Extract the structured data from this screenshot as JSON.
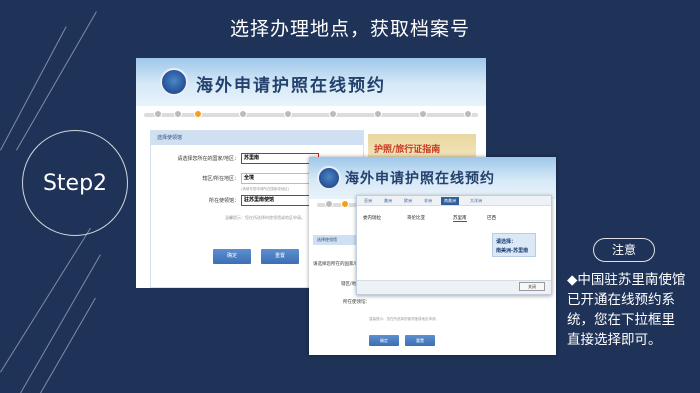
{
  "slide": {
    "title": "选择办理地点，获取档案号",
    "step_label": "Step2",
    "note_label": "注意",
    "note_text": "◆中国驻苏里南使馆已开通在线预约系统，您在下拉框里直接选择即可。"
  },
  "shot1": {
    "banner_title": "海外申请护照在线预约",
    "form_header": "选择使领馆",
    "fields": [
      {
        "label": "请选择您所在的国家/地区：",
        "value": "苏里南"
      },
      {
        "label": "辖区/所在地区：",
        "value": "全境"
      },
      {
        "label": "所在使领馆：",
        "value": "驻苏里南使馆"
      }
    ],
    "hint": "(请填写您申请所在国家或地区)",
    "footer_note": "温馨提示：您在所选择的使领馆或地区申请。",
    "ok_button": "确定",
    "reset_button": "重置",
    "ad_text": "护照/旅行证指南"
  },
  "shot2": {
    "banner_title": "海外申请护照在线预约",
    "form_header": "选择使领馆",
    "labels": [
      "请选择您所在的国家/地区：",
      "辖区/地区：",
      "所在使领馆："
    ],
    "footer_note": "温馨提示：您在所选择的使领馆或地区申请。",
    "ok_button": "确定",
    "reset_button": "重置",
    "popup": {
      "tabs": [
        "亚洲",
        "美洲",
        "欧洲",
        "非洲",
        "南美洲",
        "大洋洲"
      ],
      "active_tab": "南美洲",
      "items": [
        "委内瑞拉",
        "哥伦比亚",
        "苏里南",
        "巴西"
      ],
      "selected_item": "苏里南",
      "close_button": "关闭"
    },
    "callout_line1": "请选择：",
    "callout_line2": "南美洲-苏里南"
  }
}
